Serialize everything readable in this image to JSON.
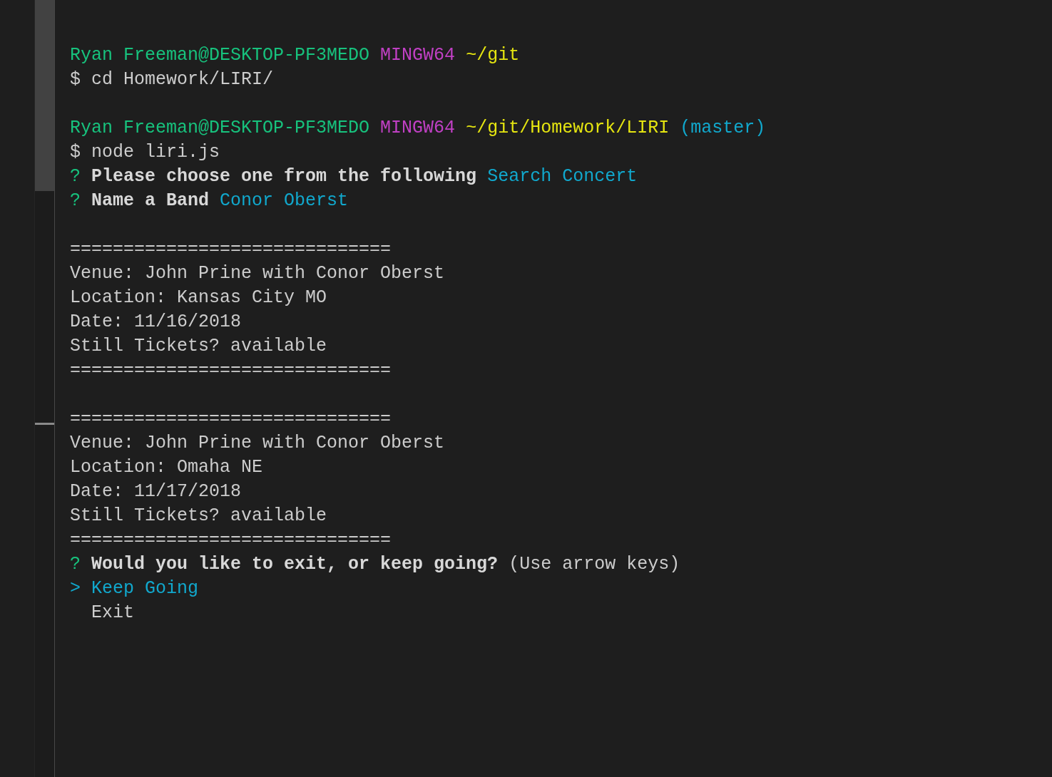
{
  "terminal": {
    "blocks": [
      {
        "lines": [
          {
            "segments": [
              {
                "kind": "user_host",
                "text": "Ryan Freeman@DESKTOP-PF3MEDO"
              },
              {
                "kind": "system",
                "text": "MINGW64"
              },
              {
                "kind": "path",
                "text": "~/git"
              }
            ]
          },
          {
            "segments": [
              {
                "kind": "dollar",
                "text": "$"
              },
              {
                "kind": "command",
                "text": "cd Homework/LIRI/"
              }
            ]
          }
        ]
      },
      {
        "lines": [
          {
            "segments": [
              {
                "kind": "user_host",
                "text": "Ryan Freeman@DESKTOP-PF3MEDO"
              },
              {
                "kind": "system",
                "text": "MINGW64"
              },
              {
                "kind": "path",
                "text": "~/git/Homework/LIRI"
              },
              {
                "kind": "branch",
                "text": "(master)"
              }
            ]
          },
          {
            "segments": [
              {
                "kind": "dollar",
                "text": "$"
              },
              {
                "kind": "command",
                "text": "node liri.js"
              }
            ]
          },
          {
            "segments": [
              {
                "kind": "mark",
                "text": "?"
              },
              {
                "kind": "question",
                "text": "Please choose one from the following"
              },
              {
                "kind": "answer",
                "text": "Search Concert"
              }
            ]
          },
          {
            "segments": [
              {
                "kind": "mark",
                "text": "?"
              },
              {
                "kind": "question",
                "text": "Name a Band"
              },
              {
                "kind": "answer",
                "text": "Conor Oberst"
              }
            ]
          }
        ]
      },
      {
        "lines": [
          {
            "segments": [
              {
                "kind": "rule",
                "text": "=============================="
              }
            ]
          },
          {
            "segments": [
              {
                "kind": "output",
                "text": "Venue: John Prine with Conor Oberst"
              }
            ]
          },
          {
            "segments": [
              {
                "kind": "output",
                "text": "Location: Kansas City MO"
              }
            ]
          },
          {
            "segments": [
              {
                "kind": "output",
                "text": "Date: 11/16/2018"
              }
            ]
          },
          {
            "segments": [
              {
                "kind": "output",
                "text": "Still Tickets? available"
              }
            ]
          },
          {
            "segments": [
              {
                "kind": "rule",
                "text": "=============================="
              }
            ]
          }
        ]
      },
      {
        "lines": [
          {
            "segments": [
              {
                "kind": "rule",
                "text": "=============================="
              }
            ]
          },
          {
            "segments": [
              {
                "kind": "output",
                "text": "Venue: John Prine with Conor Oberst"
              }
            ]
          },
          {
            "segments": [
              {
                "kind": "output",
                "text": "Location: Omaha NE"
              }
            ]
          },
          {
            "segments": [
              {
                "kind": "output",
                "text": "Date: 11/17/2018"
              }
            ]
          },
          {
            "segments": [
              {
                "kind": "output",
                "text": "Still Tickets? available"
              }
            ]
          },
          {
            "segments": [
              {
                "kind": "rule",
                "text": "=============================="
              }
            ]
          }
        ]
      }
    ],
    "menu": {
      "mark": "?",
      "question": "Would you like to exit, or keep going?",
      "hint": "(Use arrow keys)",
      "pointer": ">",
      "options": [
        {
          "label": "Keep Going",
          "selected": true
        },
        {
          "label": "Exit",
          "selected": false
        }
      ]
    }
  }
}
